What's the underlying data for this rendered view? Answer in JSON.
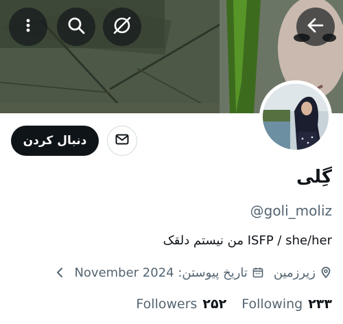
{
  "header": {
    "menu_icon": "more-vertical-icon",
    "search_icon": "search-icon",
    "grok_icon": "grok-icon",
    "back_icon": "arrow-right-icon"
  },
  "profile": {
    "display_name": "گِلی",
    "handle": "@goli_moliz",
    "bio": "ISFP / she/her من نیستم دلقک",
    "location": "زیرزمین",
    "joined": "تاریخ پیوستن: November 2024",
    "followers_label": "Followers",
    "followers_count": "۲۵۲",
    "following_label": "Following",
    "following_count": "۲۳۳"
  },
  "actions": {
    "follow_label": "دنبال کردن",
    "message_icon": "mail-icon"
  },
  "colors": {
    "primary_text": "#0f1419",
    "secondary_text": "#536471",
    "button_bg": "#0f1419"
  }
}
